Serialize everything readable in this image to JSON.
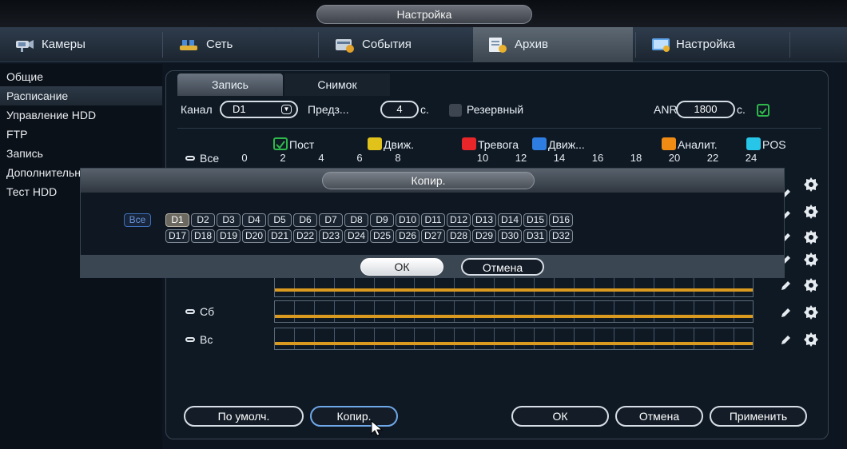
{
  "window": {
    "title": "Настройка"
  },
  "topnav": [
    {
      "label": "Камеры",
      "icon": "camera-icon",
      "active": false
    },
    {
      "label": "Сеть",
      "icon": "network-icon",
      "active": false
    },
    {
      "label": "События",
      "icon": "events-icon",
      "active": false
    },
    {
      "label": "Архив",
      "icon": "archive-icon",
      "active": true
    },
    {
      "label": "Настройка",
      "icon": "settings-icon",
      "active": false
    }
  ],
  "sidebar": {
    "items": [
      {
        "label": "Общие",
        "active": false
      },
      {
        "label": "Расписание",
        "active": true
      },
      {
        "label": "Управление HDD",
        "active": false
      },
      {
        "label": "FTP",
        "active": false
      },
      {
        "label": "Запись",
        "active": false
      },
      {
        "label": "Дополнительно",
        "active": false
      },
      {
        "label": "Тест HDD",
        "active": false
      }
    ]
  },
  "tabs": [
    {
      "label": "Запись",
      "active": true
    },
    {
      "label": "Снимок",
      "active": false
    }
  ],
  "settings": {
    "channel_label": "Канал",
    "channel_value": "D1",
    "prerecord_label": "Предз...",
    "prerecord_value": "4",
    "prerecord_unit": "с.",
    "redundant_label": "Резервный",
    "redundant_checked": false,
    "anr_label": "ANR",
    "anr_value": "1800",
    "anr_unit": "с.",
    "anr_checked": true
  },
  "legend": [
    {
      "label": "Пост",
      "color": "#2fb84a",
      "checked": true
    },
    {
      "label": "Движ.",
      "color": "#e0c21a"
    },
    {
      "label": "Тревога",
      "color": "#e8262a"
    },
    {
      "label": "Движ...",
      "color": "#2e7de2"
    },
    {
      "label": "Аналит.",
      "color": "#f08c14"
    },
    {
      "label": "POS",
      "color": "#27c6e8"
    }
  ],
  "schedule": {
    "all_label": "Все",
    "hours": [
      "0",
      "2",
      "4",
      "6",
      "8",
      "10",
      "12",
      "14",
      "16",
      "18",
      "20",
      "22",
      "24"
    ],
    "days": [
      "Сб",
      "Вс"
    ],
    "record_color": "#d99a1f"
  },
  "footer": {
    "default_label": "По умолч.",
    "copy_label": "Копир.",
    "ok_label": "ОК",
    "cancel_label": "Отмена",
    "apply_label": "Применить"
  },
  "modal": {
    "title": "Копир.",
    "all_label": "Все",
    "channels": [
      "D1",
      "D2",
      "D3",
      "D4",
      "D5",
      "D6",
      "D7",
      "D8",
      "D9",
      "D10",
      "D11",
      "D12",
      "D13",
      "D14",
      "D15",
      "D16",
      "D17",
      "D18",
      "D19",
      "D20",
      "D21",
      "D22",
      "D23",
      "D24",
      "D25",
      "D26",
      "D27",
      "D28",
      "D29",
      "D30",
      "D31",
      "D32"
    ],
    "selected": "D1",
    "ok_label": "ОК",
    "cancel_label": "Отмена"
  }
}
